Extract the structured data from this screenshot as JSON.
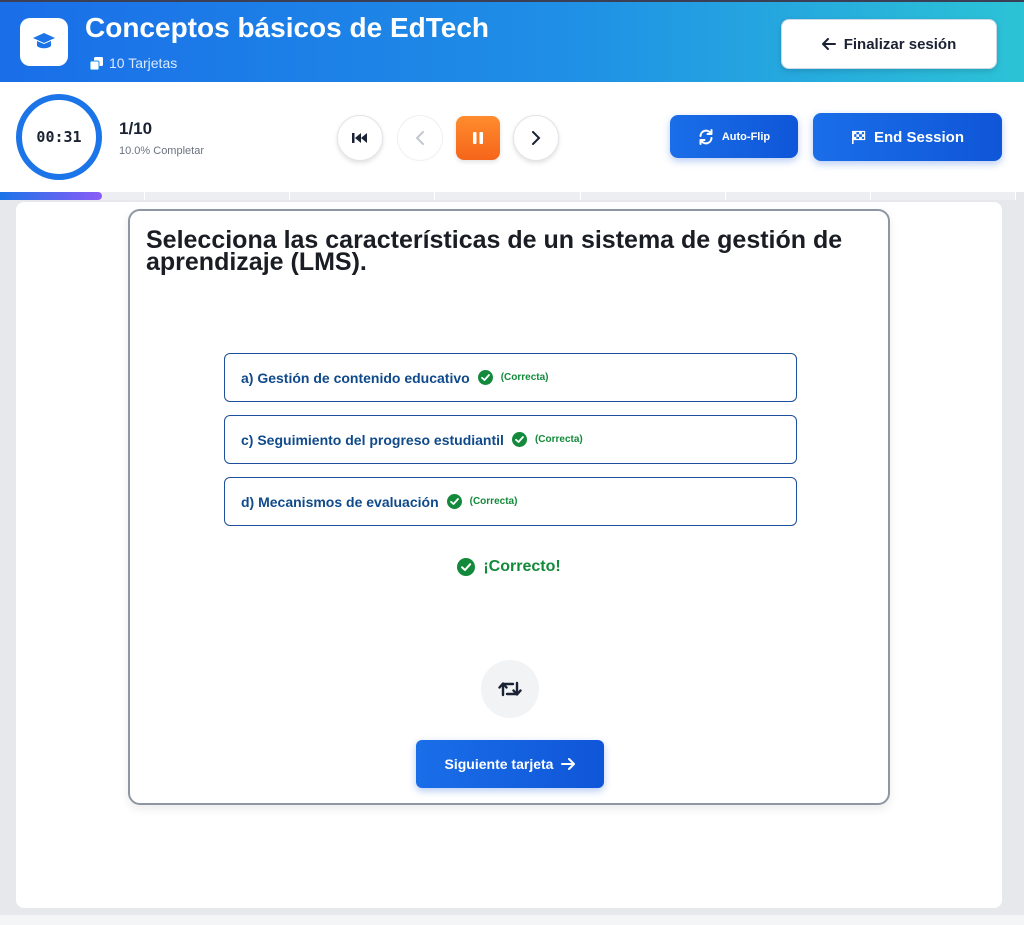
{
  "header": {
    "title": "Conceptos básicos de EdTech",
    "card_count": "10 Tarjetas",
    "finish_label": "Finalizar sesión"
  },
  "toolbar": {
    "timer": "00:31",
    "count": "1/10",
    "percent": "10.0% Completar",
    "autoflip_label": "Auto-Flip",
    "end_label": "End Session"
  },
  "progress": {
    "value": 0.1,
    "segments": 7
  },
  "card": {
    "question": "Selecciona las características de un sistema de gestión de aprendizaje (LMS).",
    "options": [
      {
        "label": "a)  Gestión de contenido educativo",
        "status": "(Correcta)"
      },
      {
        "label": "c)  Seguimiento del progreso estudiantil",
        "status": "(Correcta)"
      },
      {
        "label": "d)  Mecanismos de evaluación",
        "status": "(Correcta)"
      }
    ],
    "feedback": "¡Correcto!",
    "next_label": "Siguiente tarjeta"
  },
  "colors": {
    "accent": "#1a6ee8",
    "success": "#138a3b",
    "pause": "#f5651a"
  }
}
